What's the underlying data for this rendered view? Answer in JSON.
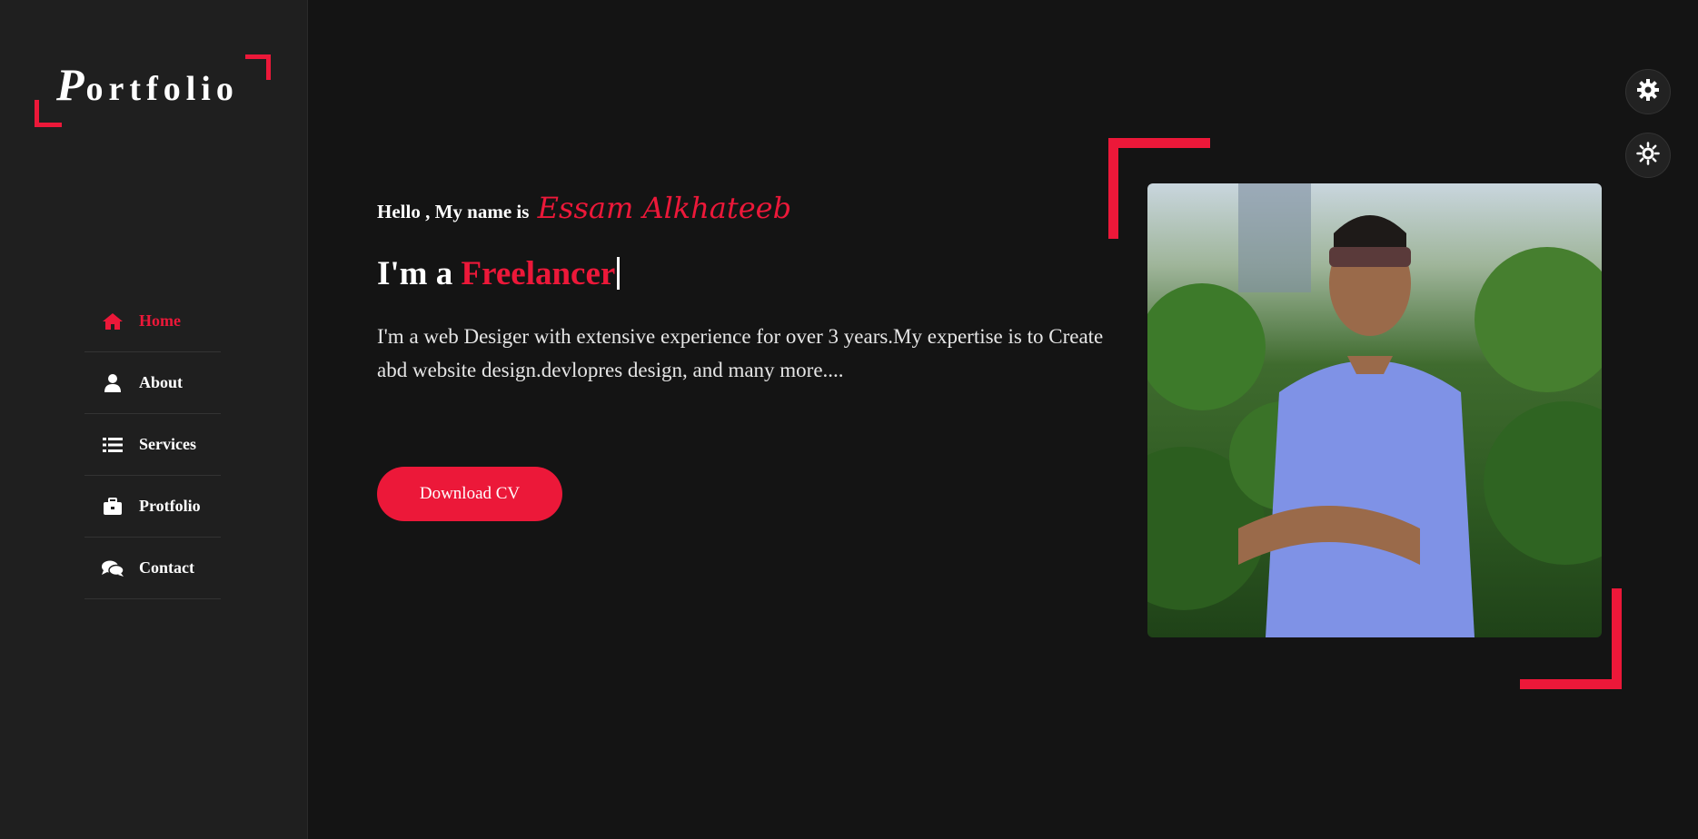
{
  "brand": {
    "logo_first": "P",
    "logo_rest": "ortfolio",
    "accent": "#ec1839"
  },
  "nav": {
    "items": [
      {
        "label": "Home",
        "icon": "home-icon",
        "active": true
      },
      {
        "label": "About",
        "icon": "user-icon",
        "active": false
      },
      {
        "label": "Services",
        "icon": "list-icon",
        "active": false
      },
      {
        "label": "Protfolio",
        "icon": "briefcase-icon",
        "active": false
      },
      {
        "label": "Contact",
        "icon": "comments-icon",
        "active": false
      }
    ]
  },
  "hero": {
    "greeting": "Hello , My name is",
    "name": "Essam Alkhateeb",
    "headline_prefix": "I'm a",
    "headline_role": "Freelancer",
    "description": "I'm a web Desiger with extensive experience for over 3 years.My expertise is to Create abd website design.devlopres design, and many more....",
    "cta_label": "Download CV"
  },
  "tools": {
    "settings_icon": "gear-icon",
    "theme_icon": "sun-icon"
  }
}
